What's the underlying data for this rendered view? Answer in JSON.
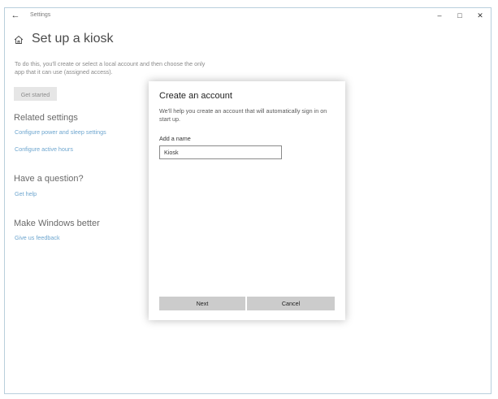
{
  "titlebar": {
    "app_title": "Settings",
    "back_icon": "arrow-left-icon",
    "minimize_icon": "minimize-icon",
    "maximize_icon": "maximize-icon",
    "close_icon": "close-icon"
  },
  "page": {
    "icon": "home-icon",
    "title": "Set up a kiosk",
    "description": "To do this, you'll create or select a local account and then choose the only app that it can use (assigned access).",
    "get_started_label": "Get started"
  },
  "related": {
    "heading": "Related settings",
    "links": [
      "Configure power and sleep settings",
      "Configure active hours"
    ]
  },
  "question": {
    "heading": "Have a question?",
    "link": "Get help"
  },
  "better": {
    "heading": "Make Windows better",
    "link": "Give us feedback"
  },
  "dialog": {
    "title": "Create an account",
    "description": "We'll help you create an account that will automatically sign in on start up.",
    "name_label": "Add a name",
    "name_value": "Kiosk",
    "next_label": "Next",
    "cancel_label": "Cancel"
  }
}
